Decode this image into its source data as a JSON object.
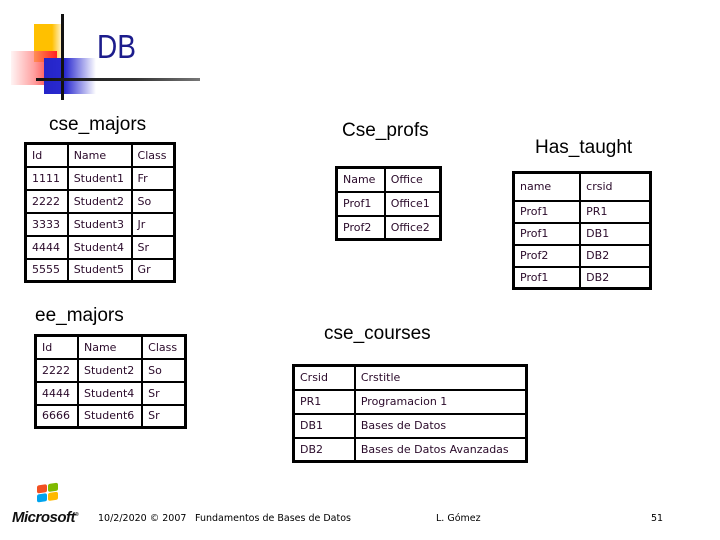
{
  "slide": {
    "title": "DB",
    "page_number": "51"
  },
  "tables": {
    "cse_majors": {
      "caption": "cse_majors",
      "headers": [
        "Id",
        "Name",
        "Class"
      ],
      "rows": [
        [
          "1111",
          "Student1",
          "Fr"
        ],
        [
          "2222",
          "Student2",
          "So"
        ],
        [
          "3333",
          "Student3",
          "Jr"
        ],
        [
          "4444",
          "Student4",
          "Sr"
        ],
        [
          "5555",
          "Student5",
          "Gr"
        ]
      ]
    },
    "cse_profs": {
      "caption": "Cse_profs",
      "headers": [
        "Name",
        "Office"
      ],
      "rows": [
        [
          "Prof1",
          "Office1"
        ],
        [
          "Prof2",
          "Office2"
        ]
      ]
    },
    "has_taught": {
      "caption": "Has_taught",
      "headers": [
        "name",
        "crsid"
      ],
      "rows": [
        [
          "Prof1",
          "PR1"
        ],
        [
          "Prof1",
          "DB1"
        ],
        [
          "Prof2",
          "DB2"
        ],
        [
          "Prof1",
          "DB2"
        ]
      ]
    },
    "ee_majors": {
      "caption": "ee_majors",
      "headers": [
        "Id",
        "Name",
        "Class"
      ],
      "rows": [
        [
          "2222",
          "Student2",
          "So"
        ],
        [
          "4444",
          "Student4",
          "Sr"
        ],
        [
          "6666",
          "Student6",
          "Sr"
        ]
      ]
    },
    "cse_courses": {
      "caption": "cse_courses",
      "headers": [
        "Crsid",
        "Crstitle"
      ],
      "rows": [
        [
          "PR1",
          "Programacion 1"
        ],
        [
          "DB1",
          "Bases de Datos"
        ],
        [
          "DB2",
          "Bases de Datos Avanzadas"
        ]
      ]
    }
  },
  "footer": {
    "logo_text": "Microsoft",
    "logo_mark": "®",
    "date_copyright": "10/2/2020 © 2007",
    "course": "Fundamentos de Bases de Datos",
    "author": "L. Gómez",
    "page": "51"
  },
  "colors": {
    "title": "#1c1c8c",
    "deco_yellow": "#ffc000",
    "deco_red": "#ff2020",
    "deco_blue": "#2424c8",
    "flag_red": "#f25022",
    "flag_green": "#7fba00",
    "flag_blue": "#00a4ef",
    "flag_yellow": "#ffb900"
  }
}
